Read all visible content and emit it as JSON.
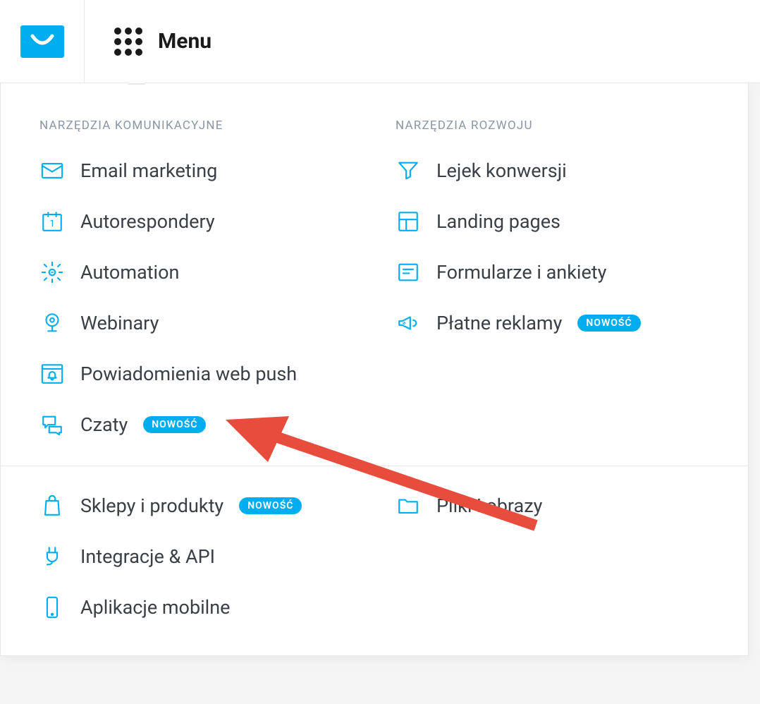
{
  "header": {
    "menu_label": "Menu"
  },
  "dropdown": {
    "col1_header": "NARZĘDZIA KOMUNIKACYJNE",
    "col2_header": "NARZĘDZIA ROZWOJU",
    "badge_text": "NOWOŚĆ",
    "col1": [
      {
        "label": "Email marketing"
      },
      {
        "label": "Autorespondery"
      },
      {
        "label": "Automation"
      },
      {
        "label": "Webinary"
      },
      {
        "label": "Powiadomienia web push"
      },
      {
        "label": "Czaty",
        "badge": true
      }
    ],
    "col2": [
      {
        "label": "Lejek konwersji"
      },
      {
        "label": "Landing pages"
      },
      {
        "label": "Formularze i ankiety"
      },
      {
        "label": "Płatne reklamy",
        "badge": true
      }
    ],
    "bottom_col1": [
      {
        "label": "Sklepy i produkty",
        "badge": true
      },
      {
        "label": "Integracje & API"
      },
      {
        "label": "Aplikacje mobilne"
      }
    ],
    "bottom_col2": [
      {
        "label": "Pliki i obrazy"
      }
    ]
  }
}
